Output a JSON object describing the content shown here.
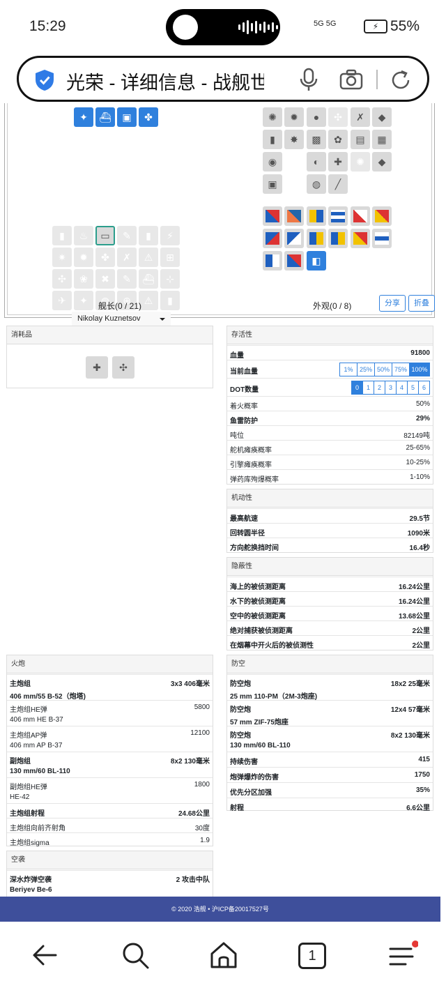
{
  "status": {
    "time": "15:29",
    "battery": "55%",
    "signal": "5G 5G"
  },
  "url": {
    "title": "光荣 - 详细信息 - 战舰世界"
  },
  "build": {
    "captain_title": "舰长(0 / 21)",
    "captain_name": "Nikolay Kuznetsov",
    "appearance_title": "外观(0 / 8)",
    "share": "分享",
    "collapse": "折叠"
  },
  "consumables": {
    "title": "消耗品"
  },
  "survivability": {
    "title": "存活性",
    "rows": [
      {
        "k": "血量",
        "v": "91800",
        "bold": true
      },
      {
        "k": "当前血量",
        "v": "",
        "bold": true
      },
      {
        "k": "DOT数量",
        "v": "",
        "bold": true
      },
      {
        "k": "着火概率",
        "v": "50%",
        "bold": false
      },
      {
        "k": "鱼雷防护",
        "v": "29%",
        "bold": true
      },
      {
        "k": "吨位",
        "v": "82149吨",
        "bold": false
      },
      {
        "k": "舵机瘫痪概率",
        "v": "25-65%",
        "bold": false
      },
      {
        "k": "引擎瘫痪概率",
        "v": "10-25%",
        "bold": false
      },
      {
        "k": "弹药库殉爆概率",
        "v": "1-10%",
        "bold": false
      }
    ],
    "hp_pct": [
      "1%",
      "25%",
      "50%",
      "75%",
      "100%"
    ],
    "hp_pct_selected": "100%",
    "dot": [
      "0",
      "1",
      "2",
      "3",
      "4",
      "5",
      "6"
    ],
    "dot_selected": "0"
  },
  "mobility": {
    "title": "机动性",
    "rows": [
      {
        "k": "最高航速",
        "v": "29.5节"
      },
      {
        "k": "回转圆半径",
        "v": "1090米"
      },
      {
        "k": "方向舵换挡时间",
        "v": "16.4秒"
      }
    ]
  },
  "concealment": {
    "title": "隐蔽性",
    "rows": [
      {
        "k": "海上的被侦测距离",
        "v": "16.24公里"
      },
      {
        "k": "水下的被侦测距离",
        "v": "16.24公里"
      },
      {
        "k": "空中的被侦测距离",
        "v": "13.68公里"
      },
      {
        "k": "绝对捕获被侦测距离",
        "v": "2公里"
      },
      {
        "k": "在烟幕中开火后的被侦测性",
        "v": "2公里"
      }
    ]
  },
  "artillery": {
    "title": "火炮",
    "rows": [
      {
        "k": "主炮组",
        "k2": "406 mm/55 B-52（炮塔)",
        "v": "3x3 406毫米",
        "bold": true
      },
      {
        "k": "主炮组HE弹",
        "k2": "406 mm HE B-37",
        "v": "5800",
        "bold": false
      },
      {
        "k": "主炮组AP弹",
        "k2": "406 mm AP B-37",
        "v": "12100",
        "bold": false
      },
      {
        "k": "副炮组",
        "k2": "130 mm/60 BL-110",
        "v": "8x2 130毫米",
        "bold": true
      },
      {
        "k": "副炮组HE弹",
        "k2": "HE-42",
        "v": "1800",
        "bold": false
      },
      {
        "k": "主炮组射程",
        "k2": "",
        "v": "24.68公里",
        "bold": true
      },
      {
        "k": "主炮组向前齐射角",
        "k2": "",
        "v": "30度",
        "bold": false
      },
      {
        "k": "主炮组sigma",
        "k2": "",
        "v": "1.9",
        "bold": false
      }
    ]
  },
  "airstrike": {
    "title": "空袭",
    "rows": [
      {
        "k": "深水炸弹空袭",
        "k2": "Beriyev Be-6",
        "v": "2 攻击中队",
        "bold": true
      }
    ]
  },
  "aa": {
    "title": "防空",
    "rows": [
      {
        "k": "防空炮",
        "k2": "25 mm 110-PM（2M-3炮座)",
        "v": "18x2 25毫米",
        "bold": true
      },
      {
        "k": "防空炮",
        "k2": "57 mm ZIF-75炮座",
        "v": "12x4 57毫米",
        "bold": true
      },
      {
        "k": "防空炮",
        "k2": "130 mm/60 BL-110",
        "v": "8x2 130毫米",
        "bold": true
      },
      {
        "k": "持续伤害",
        "k2": "",
        "v": "415",
        "bold": true
      },
      {
        "k": "炮弹爆炸的伤害",
        "k2": "",
        "v": "1750",
        "bold": true
      },
      {
        "k": "优先分区加强",
        "k2": "",
        "v": "35%",
        "bold": true
      },
      {
        "k": "射程",
        "k2": "",
        "v": "6.6公里",
        "bold": true
      }
    ]
  },
  "footer": {
    "text": "© 2020 浩舰 • 沪ICP备20017527号"
  },
  "nav": {
    "tabs": "1"
  }
}
